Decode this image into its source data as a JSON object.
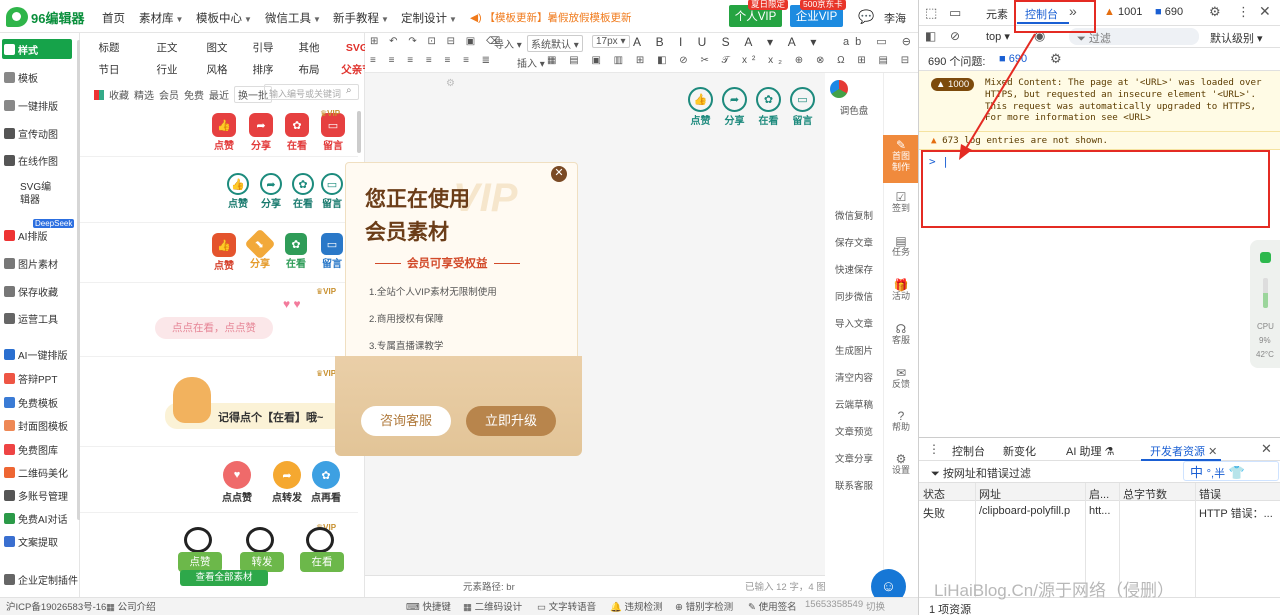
{
  "topnav": {
    "logo_text": "96编辑器",
    "items": [
      "首页",
      "素材库",
      "模板中心",
      "微信工具",
      "新手教程",
      "定制设计"
    ],
    "notice": "【模板更新】暑假放假模板更新",
    "personal_vip": "个人VIP",
    "personal_badge": "夏日限定",
    "company_vip": "企业VIP",
    "company_badge": "500京东卡",
    "username": "李海"
  },
  "sidebar": {
    "items": [
      "样式",
      "模板",
      "一键排版",
      "宣传动图",
      "在线作图",
      "SVG编辑器",
      "AI排版",
      "图片素材",
      "保存收藏",
      "运营工具",
      "AI一键排版",
      "答辩PPT",
      "免费模板",
      "封面图模板",
      "免费图库",
      "二维码美化",
      "多账号管理",
      "免费AI对话",
      "文案提取",
      "企业定制插件"
    ],
    "deepseek_badge": "DeepSeek"
  },
  "categories": {
    "row1": [
      "标题",
      "正文",
      "图文",
      "引导",
      "其他",
      "SVG"
    ],
    "row2": [
      "节日",
      "行业",
      "风格",
      "排序",
      "布局",
      "父亲节"
    ],
    "filters": [
      "收藏",
      "精选",
      "会员",
      "免费",
      "最近"
    ],
    "shuffle": "换一批",
    "search_placeholder": "输入编号或关键词"
  },
  "templates": {
    "like": "点赞",
    "share": "分享",
    "look": "在看",
    "comment": "留言",
    "vip": "VIP",
    "bubble_text": "点点在看，点点赞",
    "banner_text": "记得点个【在看】哦~",
    "row6_labels": [
      "点点赞",
      "点转发",
      "点再看"
    ],
    "panda_labels": [
      "点赞",
      "转发",
      "在看"
    ],
    "view_all": "查看全部素材"
  },
  "toolbar": {
    "insert": "导入",
    "font_default": "系统默认",
    "font_size": "17px",
    "insert2": "插入"
  },
  "editor": {
    "icons": [
      "点赞",
      "分享",
      "在看",
      "留言"
    ],
    "path_label": "元素路径:",
    "path_value": "br",
    "char_count": "已输入 12 字，4 图",
    "palette": "调色盘"
  },
  "right_tools": [
    "微信复制",
    "保存文章",
    "快速保存",
    "同步微信",
    "导入文章",
    "生成图片",
    "清空内容",
    "云端草稿",
    "文章预览",
    "文章分享",
    "联系客服"
  ],
  "side_icons": [
    "首图制作",
    "签到",
    "任务",
    "活动",
    "客服",
    "反馈",
    "帮助",
    "设置"
  ],
  "bottom_bar": {
    "icp": "沪ICP备19026583号-16",
    "company": "公司介绍",
    "items": [
      "快捷键",
      "二维码设计",
      "文字转语音",
      "违规检测",
      "错别字检测",
      "使用签名"
    ],
    "phone": "15653358549",
    "switch": "切换"
  },
  "modal": {
    "title_line1": "您正在使用",
    "title_line2": "会员素材",
    "watermark": "VIP",
    "benefits_title": "会员可享受权益",
    "benefits": [
      "1.全站个人VIP素材无限制使用",
      "2.商用授权有保障",
      "3.专属直播课教学"
    ],
    "consult": "咨询客服",
    "upgrade": "立即升级"
  },
  "devtools": {
    "tabs": [
      "元素",
      "控制台"
    ],
    "warn_count": "1001",
    "msg_count": "690",
    "context": "top",
    "filter_placeholder": "过滤",
    "level": "默认级别",
    "issues_label": "690 个问题:",
    "issues_count": "690",
    "warn_badge": "1000",
    "warn_message": "Mixed Content: The page at '<URL>' was loaded over HTTPS, but requested an insecure element '<URL>'. This request was automatically upgraded to HTTPS, For more information see <URL>",
    "hidden_note": "673 log entries are not shown.",
    "prompt": ">",
    "drawer_tabs": [
      "控制台",
      "新变化",
      "AI 助理",
      "开发者资源"
    ],
    "url_filter": "按网址和错误过滤",
    "table_headers": [
      "状态",
      "网址",
      "启...",
      "总字节数",
      "错误"
    ],
    "table_row": [
      "失败",
      "/clipboard-polyfill.p",
      "htt...",
      "",
      "HTTP 错误：..."
    ],
    "footer": "1 项资源",
    "ime": "中",
    "ime_half": "°,半",
    "cpu_label": "CPU",
    "cpu_val": "9%",
    "temp": "42°C"
  },
  "watermark": "LiHaiBlog.Cn/源于网络（侵删）"
}
